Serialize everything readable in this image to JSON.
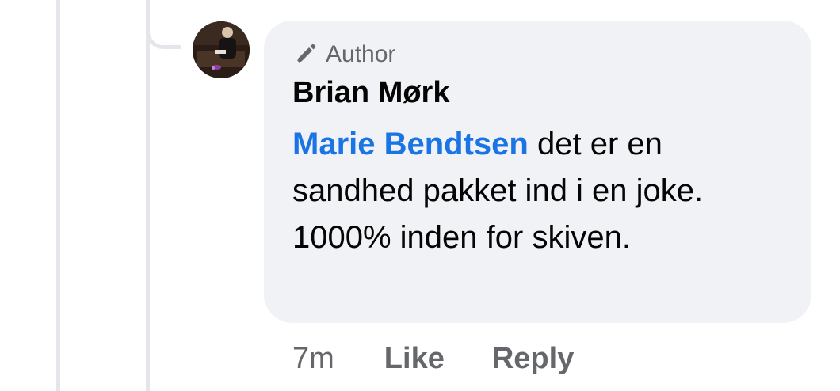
{
  "comment": {
    "badge": {
      "icon": "pencil-icon",
      "label": "Author"
    },
    "author_name": "Brian Mørk",
    "mention": "Marie Bendtsen",
    "text": " det er en sandhed pakket ind i en joke. 1000% inden for skiven.",
    "avatar": "avatar"
  },
  "actions": {
    "timestamp": "7m",
    "like_label": "Like",
    "reply_label": "Reply"
  },
  "colors": {
    "mention": "#1b74e4",
    "bubble": "#f0f2f5",
    "muted": "#65676b",
    "text": "#050505"
  }
}
